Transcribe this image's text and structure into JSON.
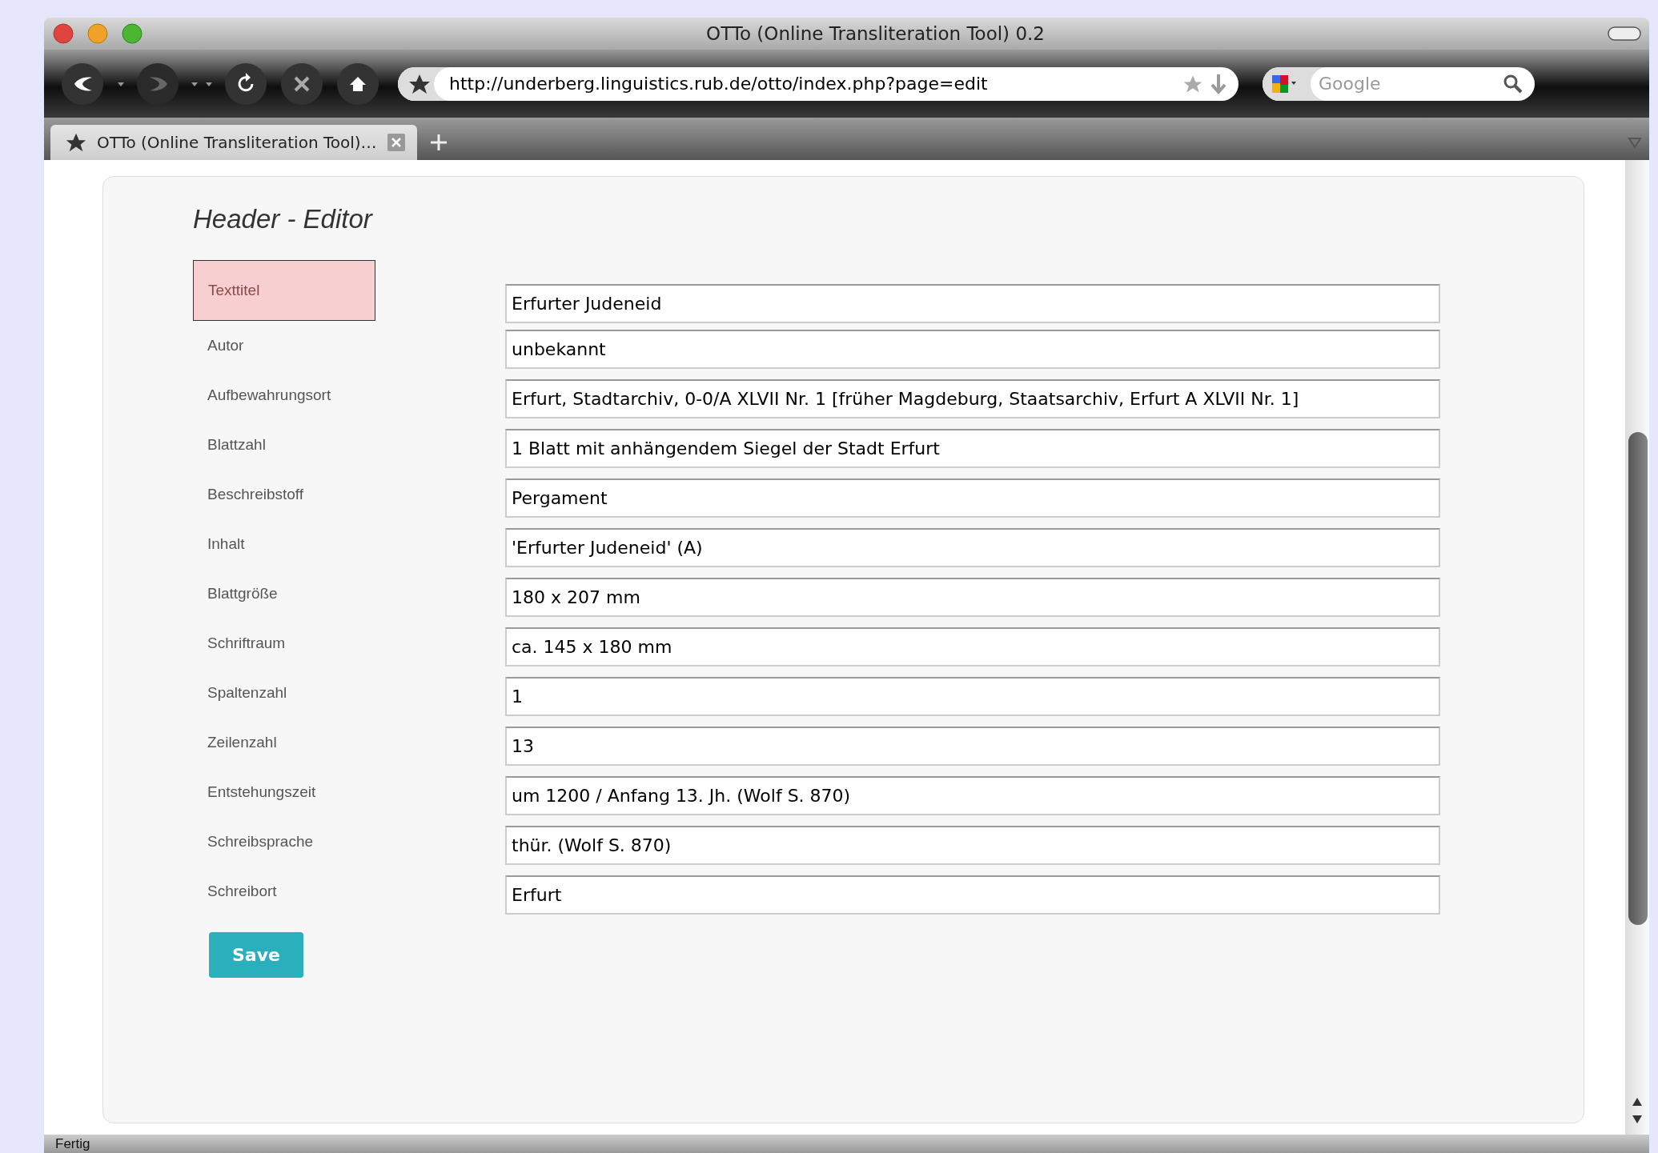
{
  "window": {
    "title": "OTTo (Online Transliteration Tool) 0.2"
  },
  "toolbar": {
    "url": "http://underberg.linguistics.rub.de/otto/index.php?page=edit",
    "search_placeholder": "Google"
  },
  "tabs": [
    {
      "label": "OTTo (Online Transliteration Tool)…",
      "selected": true
    }
  ],
  "editor": {
    "title": "Header - Editor",
    "fields": [
      {
        "label": "Texttitel",
        "value": "Erfurter Judeneid",
        "highlighted": true
      },
      {
        "label": "Autor",
        "value": "unbekannt",
        "highlighted": false
      },
      {
        "label": "Aufbewahrungsort",
        "value": "Erfurt, Stadtarchiv, 0-0/A XLVII Nr. 1 [früher Magdeburg, Staatsarchiv, Erfurt A XLVII Nr. 1]",
        "highlighted": false
      },
      {
        "label": "Blattzahl",
        "value": "1 Blatt mit anhängendem Siegel der Stadt Erfurt",
        "highlighted": false
      },
      {
        "label": "Beschreibstoff",
        "value": "Pergament",
        "highlighted": false
      },
      {
        "label": "Inhalt",
        "value": "'Erfurter Judeneid' (A)",
        "highlighted": false
      },
      {
        "label": "Blattgröße",
        "value": "180 x 207 mm",
        "highlighted": false
      },
      {
        "label": "Schriftraum",
        "value": "ca. 145 x 180 mm",
        "highlighted": false
      },
      {
        "label": "Spaltenzahl",
        "value": "1",
        "highlighted": false
      },
      {
        "label": "Zeilenzahl",
        "value": "13",
        "highlighted": false
      },
      {
        "label": "Entstehungszeit",
        "value": "um 1200 / Anfang 13. Jh. (Wolf S. 870)",
        "highlighted": false
      },
      {
        "label": "Schreibsprache",
        "value": "thür. (Wolf S. 870)",
        "highlighted": false
      },
      {
        "label": "Schreibort",
        "value": "Erfurt",
        "highlighted": false
      }
    ],
    "save_button": "Save"
  },
  "status_bar": "Fertig"
}
